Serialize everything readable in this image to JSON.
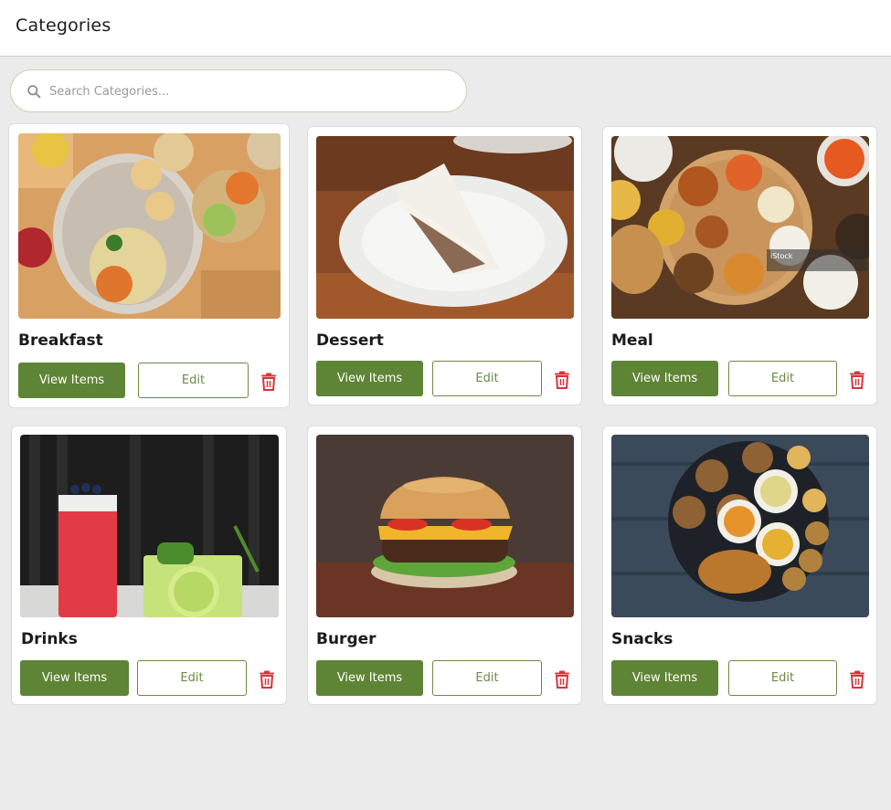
{
  "header": {
    "title": "Categories"
  },
  "search": {
    "placeholder": "Search Categories..."
  },
  "actions": {
    "view_label": "View Items",
    "edit_label": "Edit"
  },
  "icons": {
    "search": "search-icon",
    "delete": "trash-icon"
  },
  "colors": {
    "primary": "#5e8435",
    "delete": "#d9343a",
    "background": "#ebebeb"
  },
  "categories": [
    {
      "name": "Breakfast",
      "image": "breakfast-plate-photo"
    },
    {
      "name": "Dessert",
      "image": "cake-slice-photo"
    },
    {
      "name": "Meal",
      "image": "thali-meal-photo"
    },
    {
      "name": "Drinks",
      "image": "cocktail-drinks-photo"
    },
    {
      "name": "Burger",
      "image": "burger-photo"
    },
    {
      "name": "Snacks",
      "image": "snacks-platter-photo"
    }
  ]
}
